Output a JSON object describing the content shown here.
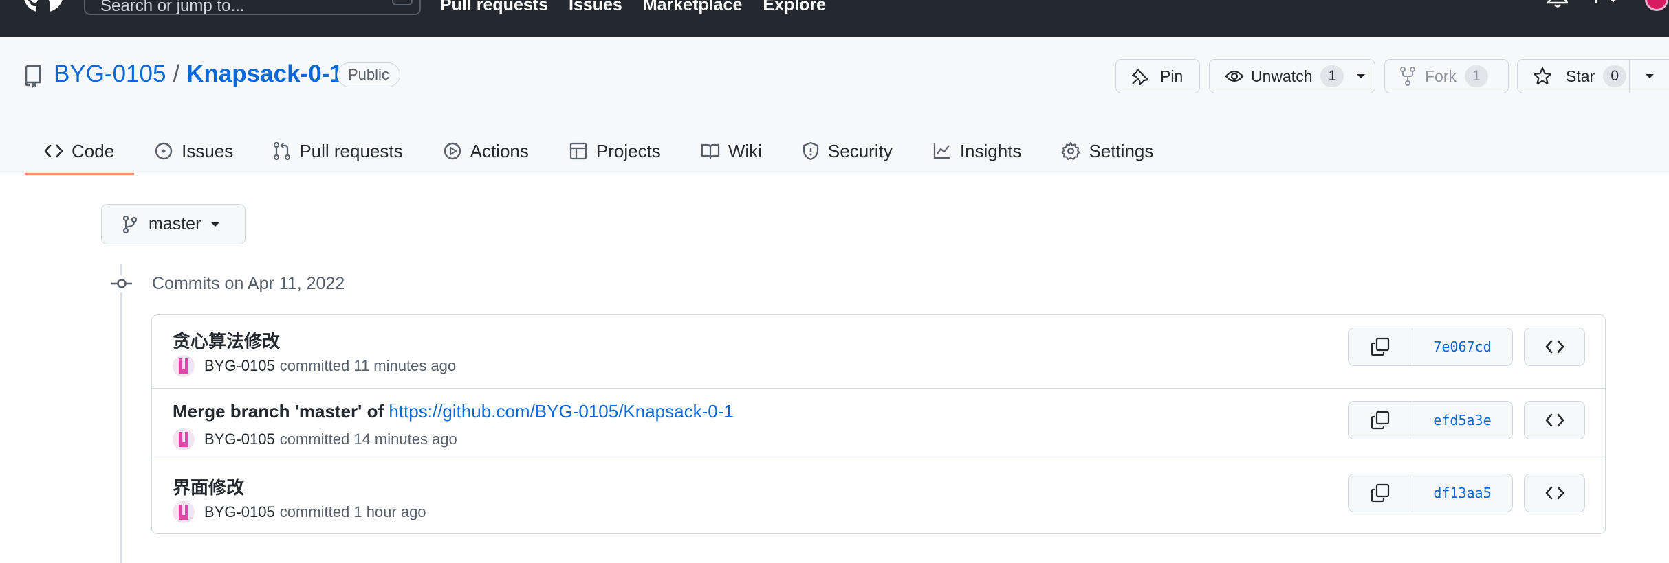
{
  "header": {
    "search_placeholder": "Search or jump to...",
    "search_shortcut": "/",
    "nav": [
      "Pull requests",
      "Issues",
      "Marketplace",
      "Explore"
    ]
  },
  "repo": {
    "owner": "BYG-0105",
    "separator": "/",
    "name": "Knapsack-0-1",
    "visibility": "Public"
  },
  "actions": {
    "pin_label": "Pin",
    "watch_label": "Unwatch",
    "watch_count": "1",
    "fork_label": "Fork",
    "fork_count": "1",
    "star_label": "Star",
    "star_count": "0"
  },
  "tabs": [
    {
      "label": "Code",
      "icon": "code-icon",
      "active": true
    },
    {
      "label": "Issues",
      "icon": "issue-icon"
    },
    {
      "label": "Pull requests",
      "icon": "pull-request-icon"
    },
    {
      "label": "Actions",
      "icon": "play-icon"
    },
    {
      "label": "Projects",
      "icon": "table-icon"
    },
    {
      "label": "Wiki",
      "icon": "book-icon"
    },
    {
      "label": "Security",
      "icon": "shield-icon"
    },
    {
      "label": "Insights",
      "icon": "graph-icon"
    },
    {
      "label": "Settings",
      "icon": "gear-icon"
    }
  ],
  "branch": {
    "name": "master"
  },
  "commit_group": {
    "title": "Commits on Apr 11, 2022"
  },
  "commits": [
    {
      "message": "贪心算法修改",
      "link": "",
      "author": "BYG-0105",
      "verb": "committed",
      "time": "11 minutes ago",
      "sha": "7e067cd"
    },
    {
      "message": "Merge branch 'master' of ",
      "link": "https://github.com/BYG-0105/Knapsack-0-1",
      "author": "BYG-0105",
      "verb": "committed",
      "time": "14 minutes ago",
      "sha": "efd5a3e"
    },
    {
      "message": "界面修改",
      "link": "",
      "author": "BYG-0105",
      "verb": "committed",
      "time": "1 hour ago",
      "sha": "df13aa5"
    }
  ],
  "colors": {
    "accent": "#0969da",
    "tab_underline": "#fd8c73",
    "header_bg": "#24292f"
  }
}
